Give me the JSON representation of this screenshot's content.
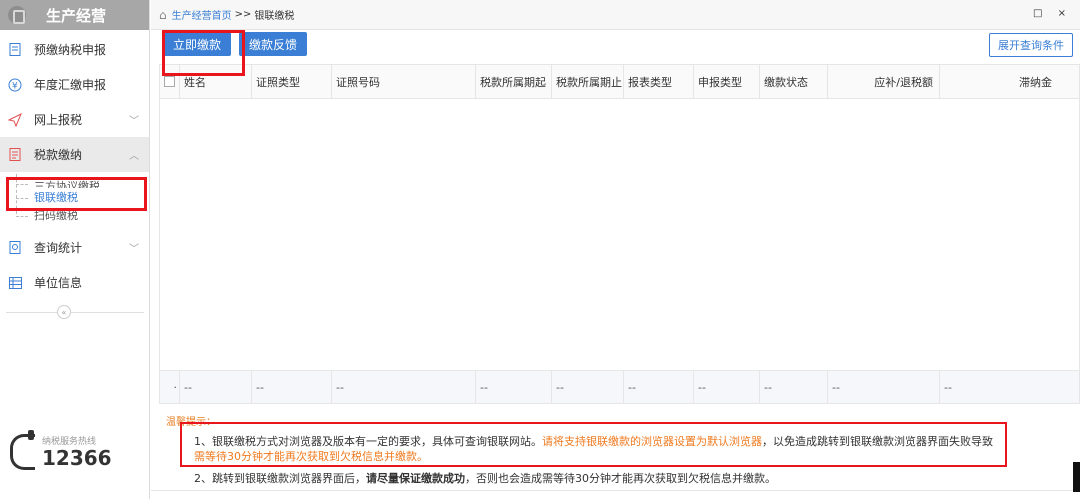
{
  "sidebar": {
    "title": "生产经营",
    "items": [
      {
        "label": "预缴纳税申报",
        "icon": "document-icon"
      },
      {
        "label": "年度汇缴申报",
        "icon": "yen-icon"
      },
      {
        "label": "网上报税",
        "icon": "send-icon"
      },
      {
        "label": "税款缴纳",
        "icon": "invoice-icon"
      },
      {
        "label": "查询统计",
        "icon": "query-icon"
      },
      {
        "label": "单位信息",
        "icon": "info-list-icon"
      }
    ],
    "sub_items": [
      "三方协议缴税",
      "银联缴税",
      "扫码缴税"
    ],
    "hotline_label": "纳税服务热线",
    "hotline_number": "12366"
  },
  "breadcrumb": {
    "home": "生产经营首页",
    "separator": ">>",
    "current": "银联缴税"
  },
  "window_controls": "□ ×",
  "toolbar": {
    "pay_now": "立即缴款",
    "feedback": "缴款反馈",
    "expand_query": "展开查询条件"
  },
  "table": {
    "columns": [
      "姓名",
      "证照类型",
      "证照号码",
      "税款所属期起",
      "税款所属期止",
      "报表类型",
      "申报类型",
      "缴款状态",
      "应补/退税额",
      "滞纳金"
    ],
    "footer": [
      "--",
      "--",
      "--",
      "--",
      "--",
      "--",
      "--",
      "--",
      "--",
      "--"
    ]
  },
  "notes": {
    "tip_title": "温馨提示：",
    "line1_a": "1、银联缴税方式对浏览器及版本有一定的要求，具体可查询银联网站。",
    "line1_b": "请将支持银联缴款的浏览器设置为默认浏览器",
    "line1_c": "，以免造成跳转到银联缴款浏览器界面失败导致",
    "line1_d": "需等待30分钟才能再次获取到欠税信息并缴款。",
    "line2_a": "2、跳转到银联缴款浏览器界面后，",
    "line2_b": "请尽量保证缴款成功",
    "line2_c": "，否则也会造成需等待30分钟才能再次获取到欠税信息并缴款。"
  },
  "colors": {
    "accent": "#3a7fd5",
    "highlight": "#e8161c",
    "warning": "#ef7a1f"
  }
}
